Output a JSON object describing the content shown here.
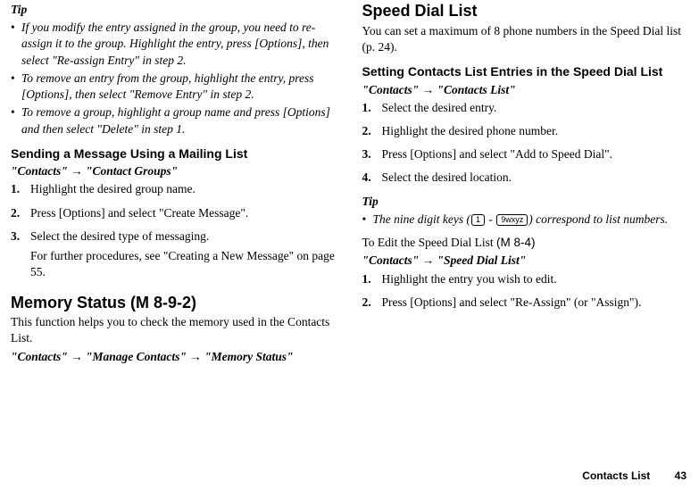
{
  "left": {
    "tip_heading": "Tip",
    "bullets": [
      "If you modify the entry assigned in the group, you need to re-assign it to the group. Highlight the entry, press [Options], then select \"Re-assign Entry\" in step 2.",
      "To remove an entry from the group, highlight the entry, press [Options], then select \"Remove Entry\" in step 2.",
      "To remove a group, highlight a group name and press [Options] and then select \"Delete\" in step 1."
    ],
    "mailing_heading": "Sending a Message Using a Mailing List",
    "mailing_path": "\"Contacts\" → \"Contact Groups\"",
    "mailing_steps": [
      "Highlight the desired group name.",
      "Press [Options] and select \"Create Message\".",
      "Select the desired type of messaging."
    ],
    "mailing_sub": "For further procedures, see \"Creating a New Message\" on page 55.",
    "memory_heading_pre": "Memory Status ",
    "memory_heading_code": "(M 8-9-2)",
    "memory_body": "This function helps you to check the memory used in the Contacts List.",
    "memory_path": "\"Contacts\" → \"Manage Contacts\" → \"Memory Status\""
  },
  "right": {
    "speed_heading": "Speed Dial List",
    "speed_body": "You can set a maximum of 8 phone numbers in the Speed Dial list (p. 24).",
    "setting_heading": "Setting Contacts List Entries in the Speed Dial List",
    "setting_path": "\"Contacts\" → \"Contacts List\"",
    "setting_steps": [
      "Select the desired entry.",
      "Highlight the desired phone number.",
      "Press [Options] and select \"Add to Speed Dial\".",
      "Select the desired location."
    ],
    "tip_heading": "Tip",
    "tip_pre": "The nine digit keys (",
    "tip_key1": "1",
    "tip_mid": " - ",
    "tip_key2": "9wxyz",
    "tip_post": ") correspond to list numbers.",
    "edit_sub_pre": "To Edit the Speed Dial List ",
    "edit_sub_code": "(M 8-4)",
    "edit_path": "\"Contacts\" → \"Speed Dial List\"",
    "edit_steps": [
      "Highlight the entry you wish to edit.",
      "Press [Options] and select \"Re-Assign\" (or \"Assign\")."
    ]
  },
  "footer": {
    "title": "Contacts List",
    "page": "43"
  }
}
